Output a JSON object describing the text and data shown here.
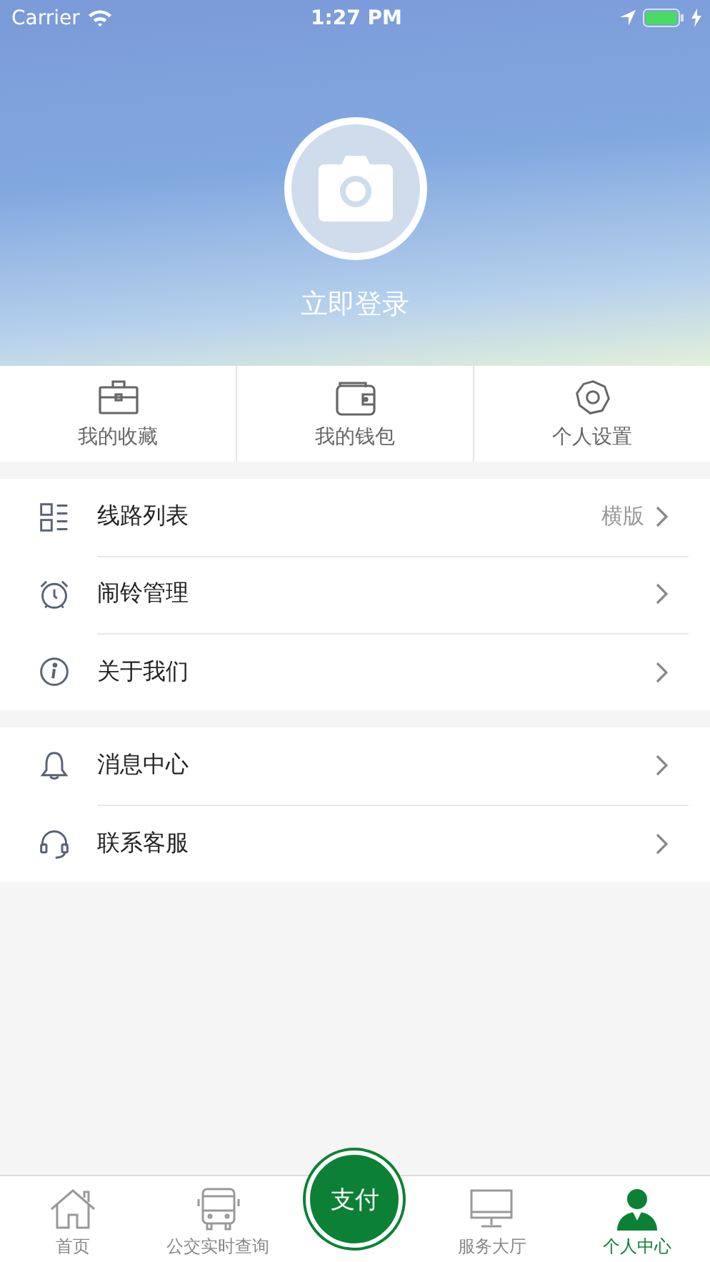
{
  "status_bar": {
    "carrier": "Carrier",
    "time": "1:27 PM"
  },
  "profile": {
    "login": "立即登录"
  },
  "quick_actions": [
    {
      "kind": "briefcase",
      "label": "我的收藏"
    },
    {
      "kind": "wallet",
      "label": "我的钱包"
    },
    {
      "kind": "gear",
      "label": "个人设置"
    }
  ],
  "menu_groups": [
    [
      {
        "kind": "list",
        "label": "线路列表",
        "value": "横版"
      },
      {
        "kind": "alarm",
        "label": "闹铃管理"
      },
      {
        "kind": "info",
        "label": "关于我们"
      }
    ],
    [
      {
        "kind": "bell",
        "label": "消息中心"
      },
      {
        "kind": "headset",
        "label": "联系客服"
      }
    ]
  ],
  "tab_bar": [
    {
      "kind": "home",
      "label": "首页",
      "selected": false
    },
    {
      "kind": "bus",
      "label": "公交实时查询",
      "selected": false
    },
    {
      "kind": "pay",
      "label": "支付",
      "selected": false
    },
    {
      "kind": "monitor",
      "label": "服务大厅",
      "selected": false
    },
    {
      "kind": "person",
      "label": "个人中心",
      "selected": true
    }
  ]
}
